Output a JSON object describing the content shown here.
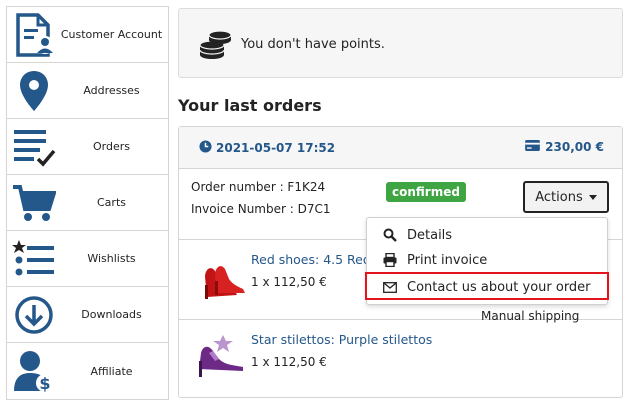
{
  "sidebar": {
    "items": [
      {
        "label": "Customer Account",
        "icon": "customer-account-icon"
      },
      {
        "label": "Addresses",
        "icon": "map-pin-icon"
      },
      {
        "label": "Orders",
        "icon": "orders-list-icon"
      },
      {
        "label": "Carts",
        "icon": "cart-icon"
      },
      {
        "label": "Wishlists",
        "icon": "wishlist-icon"
      },
      {
        "label": "Downloads",
        "icon": "download-icon"
      },
      {
        "label": "Affiliate",
        "icon": "affiliate-icon"
      }
    ]
  },
  "points": {
    "message": "You don't have points.",
    "icon": "coins-icon"
  },
  "orders": {
    "heading": "Your last orders",
    "order": {
      "date": "2021-05-07 17:52",
      "total": "230,00 €",
      "order_number": "Order number : F1K24",
      "invoice_number": "Invoice Number : D7C1",
      "status": "confirmed",
      "status_color": "#3fa442",
      "actions_label": "Actions",
      "shipping": "Manual shipping",
      "products": [
        {
          "name": "Red shoes: 4.5 Red",
          "qty": "1 x 112,50 €"
        },
        {
          "name": "Star stilettos: Purple stilettos",
          "qty": "1 x 112,50 €"
        }
      ]
    }
  },
  "dropdown": {
    "items": [
      {
        "label": "Details",
        "icon": "search-icon"
      },
      {
        "label": "Print invoice",
        "icon": "printer-icon"
      },
      {
        "label": "Contact us about your order",
        "icon": "envelope-icon"
      }
    ]
  },
  "colors": {
    "accent": "#24578a",
    "highlight": "#e2141c"
  }
}
